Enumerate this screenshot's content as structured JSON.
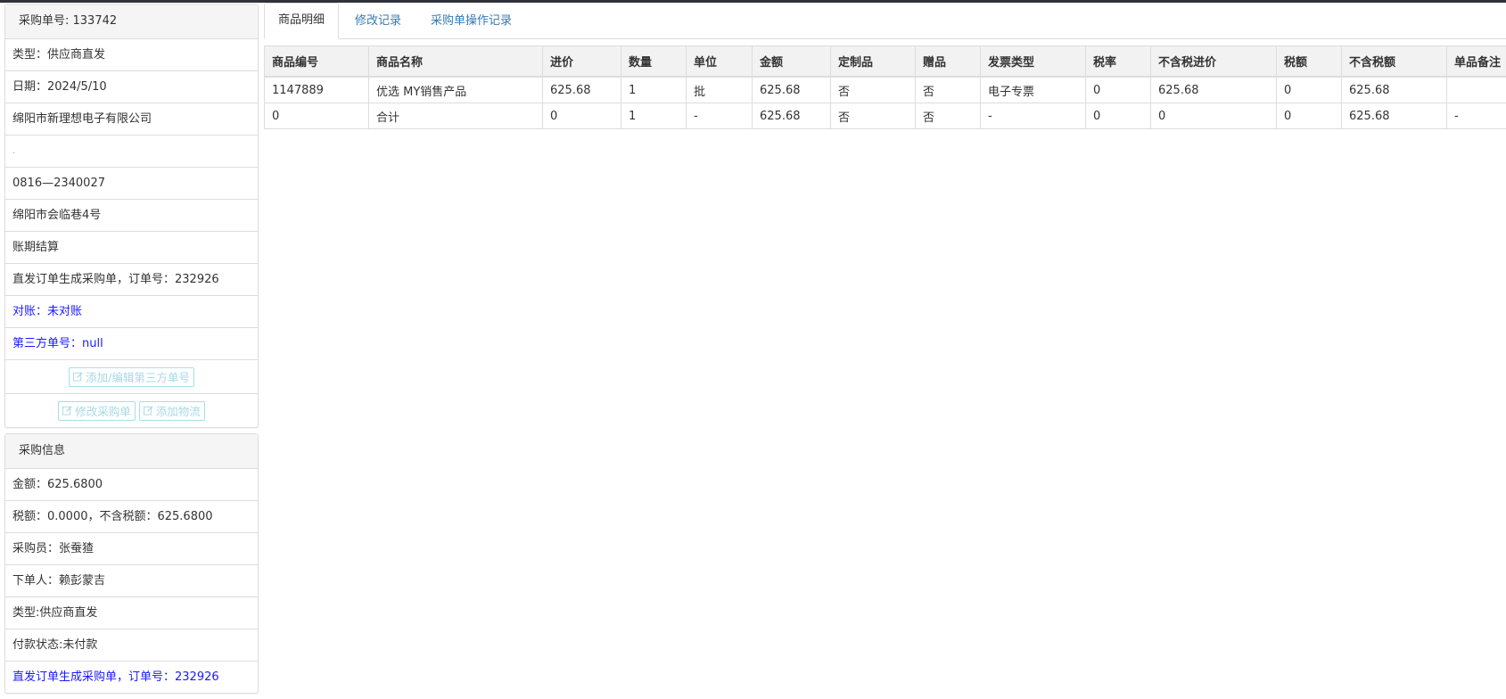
{
  "order_panel": {
    "heading": "采购单号: 133742",
    "type": "类型：供应商直发",
    "date": "日期：2024/5/10",
    "company": "绵阳市新理想电子有限公司",
    "placeholder": ".",
    "phone": "0816—2340027",
    "address": "绵阳市会临巷4号",
    "settlement": "账期结算",
    "direct_note": "直发订单生成采购单，订单号：232926",
    "reconcile": "对账：未对账",
    "third_party": "第三方单号：null",
    "btn_add_third": "添加/编辑第三方单号",
    "btn_edit_order": "修改采购单",
    "btn_add_logistics": "添加物流"
  },
  "purchase_panel": {
    "heading": "采购信息",
    "amount": "金额：625.6800",
    "tax": "税额：0.0000，不含税额：625.6800",
    "buyer": "采购员：张蚕猹",
    "orderer": "下单人：赖彭蒙吉",
    "type": "类型:供应商直发",
    "payment": "付款状态:未付款",
    "direct_note": "直发订单生成采购单，订单号：232926"
  },
  "tabs": [
    {
      "label": "商品明细",
      "active": true
    },
    {
      "label": "修改记录",
      "active": false
    },
    {
      "label": "采购单操作记录",
      "active": false
    }
  ],
  "table": {
    "headers": [
      "商品编号",
      "商品名称",
      "进价",
      "数量",
      "单位",
      "金额",
      "定制品",
      "赠品",
      "发票类型",
      "税率",
      "不含税进价",
      "税额",
      "不含税额",
      "单品备注"
    ],
    "rows": [
      [
        "1147889",
        "优选 MY销售产品",
        "625.68",
        "1",
        "批",
        "625.68",
        "否",
        "否",
        "电子专票",
        "0",
        "625.68",
        "0",
        "625.68",
        ""
      ],
      [
        "0",
        "合计",
        "0",
        "1",
        "-",
        "625.68",
        "否",
        "否",
        "-",
        "0",
        "0",
        "0",
        "625.68",
        "-"
      ]
    ]
  },
  "icons": {
    "edit": "edit-icon"
  }
}
